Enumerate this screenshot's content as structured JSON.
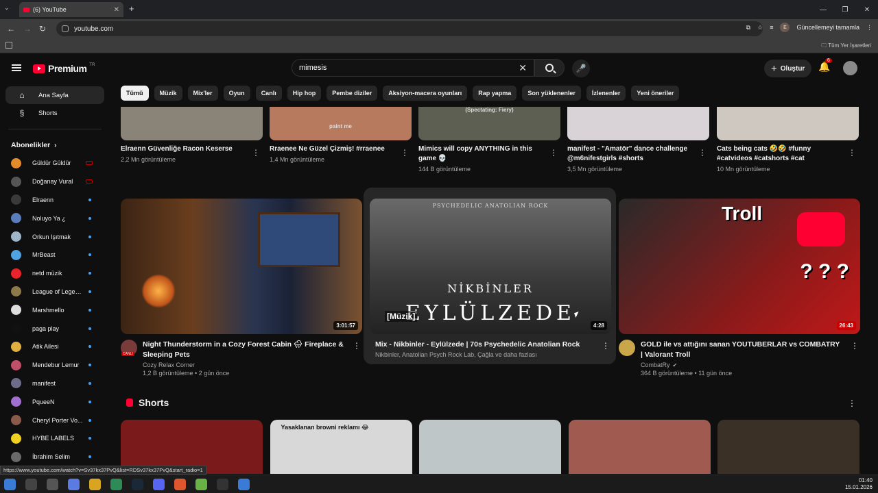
{
  "browser": {
    "tab_title": "(6) YouTube",
    "tab_close": "✕",
    "new_tab": "+",
    "tab_menu": "⌄",
    "url": "youtube.com",
    "update_label": "Güncellemeyi tamamla",
    "profile_initial": "E",
    "bookmarks_all": "Tüm Yer İşaretleri",
    "window_buttons": [
      "—",
      "❐",
      "✕"
    ],
    "nav": {
      "back": "←",
      "forward": "→",
      "reload": "↻"
    }
  },
  "header": {
    "logo_text": "Premium",
    "logo_region": "TR",
    "search_value": "mimesis",
    "clear": "✕",
    "mic": "🎤",
    "create_label": "Oluştur",
    "create_plus": "+",
    "bell": "🔔",
    "notifications": "6"
  },
  "sidebar": {
    "home": "Ana Sayfa",
    "shorts": "Shorts",
    "subs_title": "Abonelikler",
    "subs_chevron": "›",
    "subscriptions": [
      {
        "name": "Güldür Güldür",
        "color": "#e48a2b",
        "status": "live"
      },
      {
        "name": "Doğanay Vural",
        "color": "#555555",
        "status": "live"
      },
      {
        "name": "Elraenn",
        "color": "#3a3a3a",
        "status": "dot"
      },
      {
        "name": "Noluyo Ya ¿",
        "color": "#5a7dbb",
        "status": "dot"
      },
      {
        "name": "Orkun Işıtmak",
        "color": "#9fb6c9",
        "status": "dot"
      },
      {
        "name": "MrBeast",
        "color": "#4fa3e0",
        "status": "dot"
      },
      {
        "name": "netd müzik",
        "color": "#e8232a",
        "status": "dot"
      },
      {
        "name": "League of Legen...",
        "color": "#8c7a4a",
        "status": "dot"
      },
      {
        "name": "Marshmello",
        "color": "#dddddd",
        "status": "dot"
      },
      {
        "name": "paga play",
        "color": "#111111",
        "status": "dot"
      },
      {
        "name": "Atik Ailesi",
        "color": "#e0b040",
        "status": "dot"
      },
      {
        "name": "Mendebur Lemur",
        "color": "#c0506a",
        "status": "dot"
      },
      {
        "name": "manifest",
        "color": "#6d6d8a",
        "status": "dot"
      },
      {
        "name": "PqueeN",
        "color": "#a06fd0",
        "status": "dot"
      },
      {
        "name": "Cheryl Porter Vo...",
        "color": "#8a5a4a",
        "status": "dot"
      },
      {
        "name": "HYBE LABELS",
        "color": "#f0d020",
        "status": "dot"
      },
      {
        "name": "İbrahim Selim",
        "color": "#6a6a6a",
        "status": "dot"
      }
    ]
  },
  "chips": [
    "Tümü",
    "Müzik",
    "Mix'ler",
    "Oyun",
    "Canlı",
    "Hip hop",
    "Pembe diziler",
    "Aksiyon-macera oyunları",
    "Rap yapma",
    "Son yüklenenler",
    "İzlenenler",
    "Yeni öneriler"
  ],
  "row1": [
    {
      "title": "Elraenn Güvenliğe Racon Keserse",
      "meta": "2,2 Mn görüntüleme",
      "thumb": "#8a8378",
      "thumb_text": ""
    },
    {
      "title": "Rraenee Ne Güzel Çizmiş! #rraenee",
      "meta": "1,4 Mn görüntüleme",
      "thumb": "#b77a5e",
      "thumb_text": "paint me"
    },
    {
      "title": "Mimics will copy ANYTHING in this game 💀",
      "meta": "144 B görüntüleme",
      "thumb": "#5c5f52",
      "thumb_text": "(Spectating: Fiery)"
    },
    {
      "title": "manifest - \"Amatör\" dance challenge @m6nifestgirls #shorts",
      "meta": "3,5 Mn görüntüleme",
      "thumb": "#d9d2d6",
      "thumb_text": ""
    },
    {
      "title": "Cats being cats 🤣🤣 #funny #catvideos #catshorts #cat",
      "meta": "10 Mn görüntüleme",
      "thumb": "#cfc8c0",
      "thumb_text": ""
    }
  ],
  "row2": [
    {
      "title": "Night Thunderstorm in a Cozy Forest Cabin 🌧 Fireplace & Sleeping Pets",
      "channel": "Cozy Relax Corner",
      "meta": "1,2 B görüntüleme • 2 gün önce",
      "duration": "3:01:57",
      "avatar_label": "CANLI",
      "avatar_color": "#7a3b3b"
    },
    {
      "title": "Mix - Nikbinler - Eylülzede | 70s Psychedelic Anatolian Rock",
      "channel": "Nikbinler, Anatolian Psych Rock Lab, Çağla ve daha fazlası",
      "meta": "",
      "duration": "4:28",
      "thumb_top": "PSYCHEDELIC ANATOLIAN ROCK",
      "thumb_band": "NİKBİNLER",
      "thumb_song": "EYLÜLZEDE",
      "thumb_tag": "[Müzik]"
    },
    {
      "title": "GOLD ile vs attığını sanan YOUTUBERLAR vs COMBATRY | Valorant Troll",
      "channel": "CombatRy",
      "verified": "✔",
      "meta": "364 B görüntüleme • 11 gün önce",
      "duration": "26:43",
      "thumb_word": "Troll",
      "avatar_color": "#c9a64a"
    }
  ],
  "shorts": {
    "title": "Shorts",
    "items": [
      {
        "caption": "",
        "color": "#7a1a1a"
      },
      {
        "caption": "Yasaklanan browni reklamı 😂",
        "color": "#d8d8d8"
      },
      {
        "caption": "",
        "color": "#bfc6c8"
      },
      {
        "caption": "",
        "color": "#a05a50"
      },
      {
        "caption": "",
        "color": "#3a3026"
      }
    ]
  },
  "status_url": "https://www.youtube.com/watch?v=Sv37kx37PvQ&list=RDSv37kx37PvQ&start_radio=1",
  "clock": {
    "time": "01:40",
    "date": "15.01.2026"
  },
  "more": "⋮"
}
